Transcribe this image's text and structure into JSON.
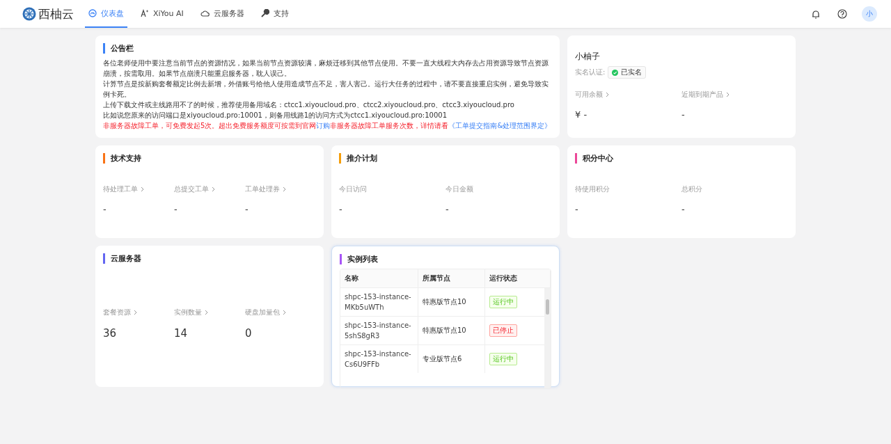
{
  "brand": {
    "name": "西柚云"
  },
  "nav": [
    {
      "label": "仪表盘",
      "selected": true
    },
    {
      "label": "XiYou AI",
      "selected": false
    },
    {
      "label": "云服务器",
      "selected": false
    },
    {
      "label": "支持",
      "selected": false
    }
  ],
  "avatar": {
    "initial": "小"
  },
  "notice": {
    "title": "公告栏",
    "color": "#3b82f6",
    "lines": [
      [
        {
          "kind": "plain",
          "text": "各位老师使用中要注意当前节点的资源情况，如果当前节点资源较满，麻烦迁移到其他节点使用。不要一直大线程大内存去占用资源导致节点资源崩溃，按需取用。如果节点崩溃只能重启服务器，耽人误己。"
        }
      ],
      [
        {
          "kind": "plain",
          "text": "计算节点是按新购套餐额定比例去新增，外借账号给他人使用造成节点不足，害人害己。运行大任务的过程中，请不要直接重启实例，避免导致实例卡死。"
        }
      ],
      [
        {
          "kind": "plain",
          "text": "上传下载文件或主线路用不了的时候，推荐使用备用域名：ctcc1.xiyoucloud.pro、ctcc2.xiyoucloud.pro、ctcc3.xiyoucloud.pro"
        }
      ],
      [
        {
          "kind": "plain",
          "text": "比如说您原来的访问端口是xiyoucloud.pro:10001，则备用线路1的访问方式为ctcc1.xiyoucloud.pro:10001"
        }
      ],
      [
        {
          "kind": "warning",
          "text": "非服务器故障工单，可免费发起5次。超出免费服务额度可按需到官网"
        },
        {
          "kind": "link",
          "text": "订购"
        },
        {
          "kind": "warning",
          "text": "非服务器故障工单服务次数，详情请看"
        },
        {
          "kind": "link",
          "text": "《工单提交指南&处理范围界定》"
        }
      ]
    ]
  },
  "user": {
    "name": "小柚子",
    "verify_label": "实名认证:",
    "verify_badge": "已实名",
    "verified": true,
    "stats": [
      {
        "label": "可用余额",
        "arrow": true,
        "value": "¥ -"
      },
      {
        "label": "近期到期产品",
        "arrow": true,
        "value": "-"
      }
    ]
  },
  "cards": [
    {
      "title": "技术支持",
      "color": "#f97316",
      "stats": [
        {
          "label": "待处理工单",
          "arrow": true,
          "value": "-"
        },
        {
          "label": "总提交工单",
          "arrow": true,
          "value": "-"
        },
        {
          "label": "工单处理券",
          "arrow": true,
          "value": "-"
        }
      ]
    },
    {
      "title": "推介计划",
      "color": "#f59e0b",
      "stats": [
        {
          "label": "今日访问",
          "arrow": false,
          "value": "-"
        },
        {
          "label": "今日金额",
          "arrow": false,
          "value": "-"
        }
      ]
    },
    {
      "title": "积分中心",
      "color": "#ec4899",
      "stats": [
        {
          "label": "待使用积分",
          "arrow": false,
          "value": "-"
        },
        {
          "label": "总积分",
          "arrow": false,
          "value": "-"
        }
      ]
    },
    {
      "title": "云服务器",
      "color": "#6366f1",
      "stats": [
        {
          "label": "套餐资源",
          "arrow": true,
          "value": "36"
        },
        {
          "label": "实例数量",
          "arrow": true,
          "value": "14"
        },
        {
          "label": "硬盘加量包",
          "arrow": true,
          "value": "0"
        }
      ]
    }
  ],
  "instances": {
    "title": "实例列表",
    "color": "#a855f7",
    "columns": [
      "名称",
      "所属节点",
      "运行状态"
    ],
    "rows": [
      {
        "name": "shpc-153-instance-MKb5uWTh",
        "node": "特惠版节点10",
        "status": "运行中",
        "kind": "running"
      },
      {
        "name": "shpc-153-instance-5shS8gR3",
        "node": "特惠版节点10",
        "status": "已停止",
        "kind": "stopped"
      },
      {
        "name": "shpc-153-instance-Cs6U9FFb",
        "node": "专业版节点6",
        "status": "运行中",
        "kind": "running"
      }
    ]
  }
}
